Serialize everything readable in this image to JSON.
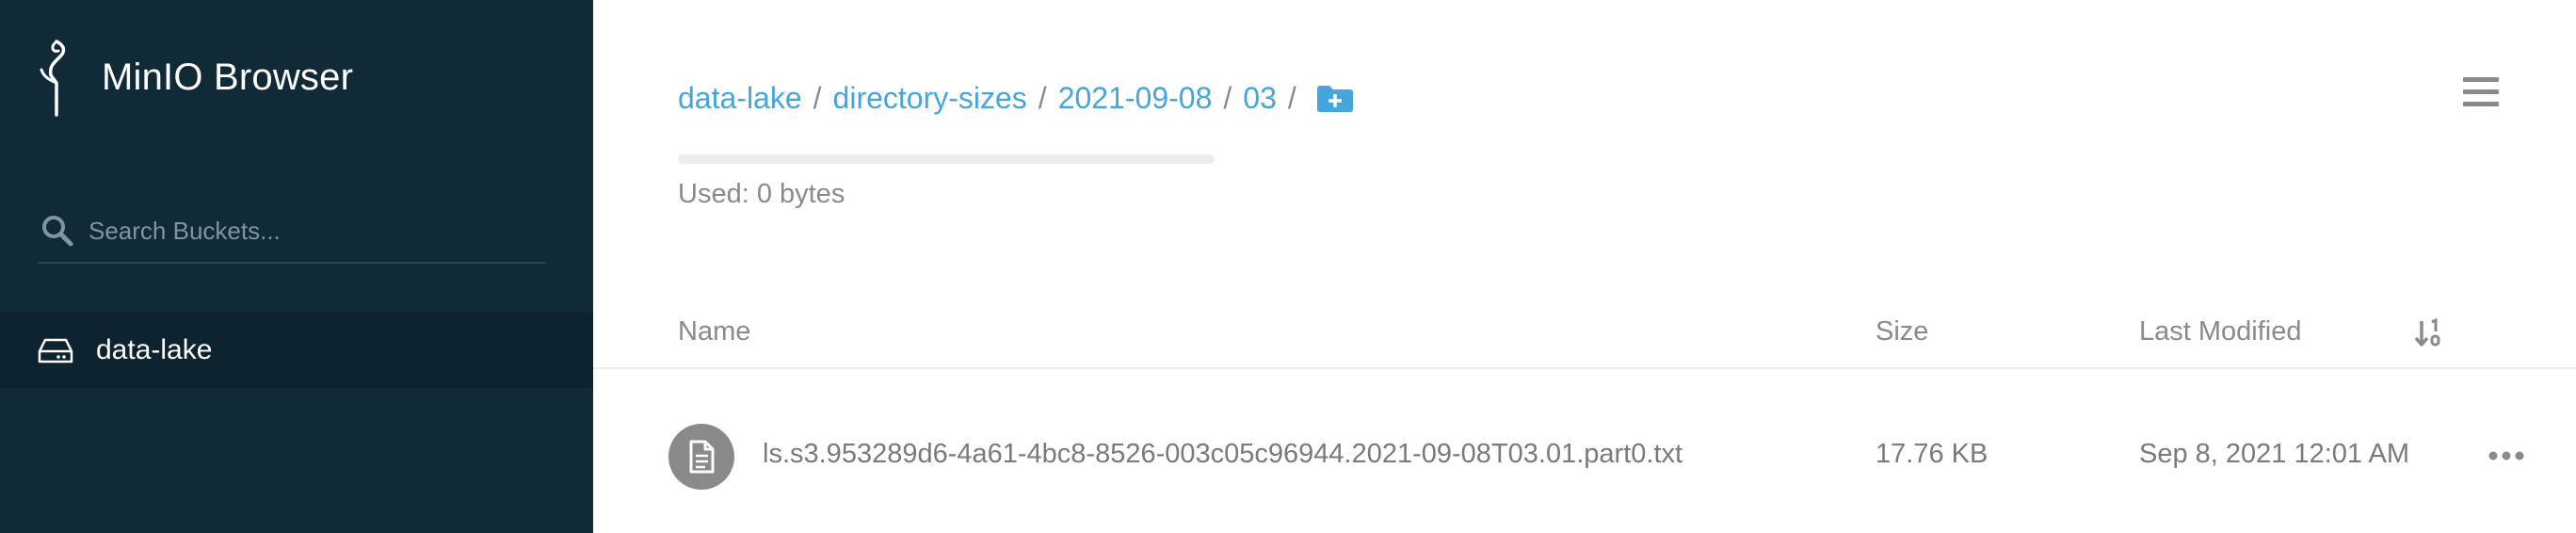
{
  "app": {
    "title": "MinIO Browser"
  },
  "sidebar": {
    "search_placeholder": "Search Buckets...",
    "buckets": [
      {
        "label": "data-lake",
        "icon": "drive-icon",
        "selected": true
      }
    ]
  },
  "header": {
    "breadcrumb": [
      {
        "label": "data-lake"
      },
      {
        "label": "directory-sizes"
      },
      {
        "label": "2021-09-08"
      },
      {
        "label": "03"
      }
    ],
    "separator": "/",
    "actions": [
      "folder-add-icon",
      "hamburger-menu-icon"
    ]
  },
  "usage": {
    "text": "Used: 0 bytes",
    "fraction": 0
  },
  "table": {
    "columns": {
      "name": "Name",
      "size": "Size",
      "last_modified": "Last Modified"
    },
    "rows": [
      {
        "name": "ls.s3.953289d6-4a61-4bc8-8526-003c05c96944.2021-09-08T03.01.part0.txt",
        "size": "17.76 KB",
        "last_modified": "Sep 8, 2021 12:01 AM",
        "icon": "file-icon"
      }
    ]
  },
  "colors": {
    "sidebar_bg": "#112a38",
    "sidebar_selected_bg": "#0d2330",
    "accent": "#46a6dc",
    "muted_text": "#8a8a8a"
  }
}
